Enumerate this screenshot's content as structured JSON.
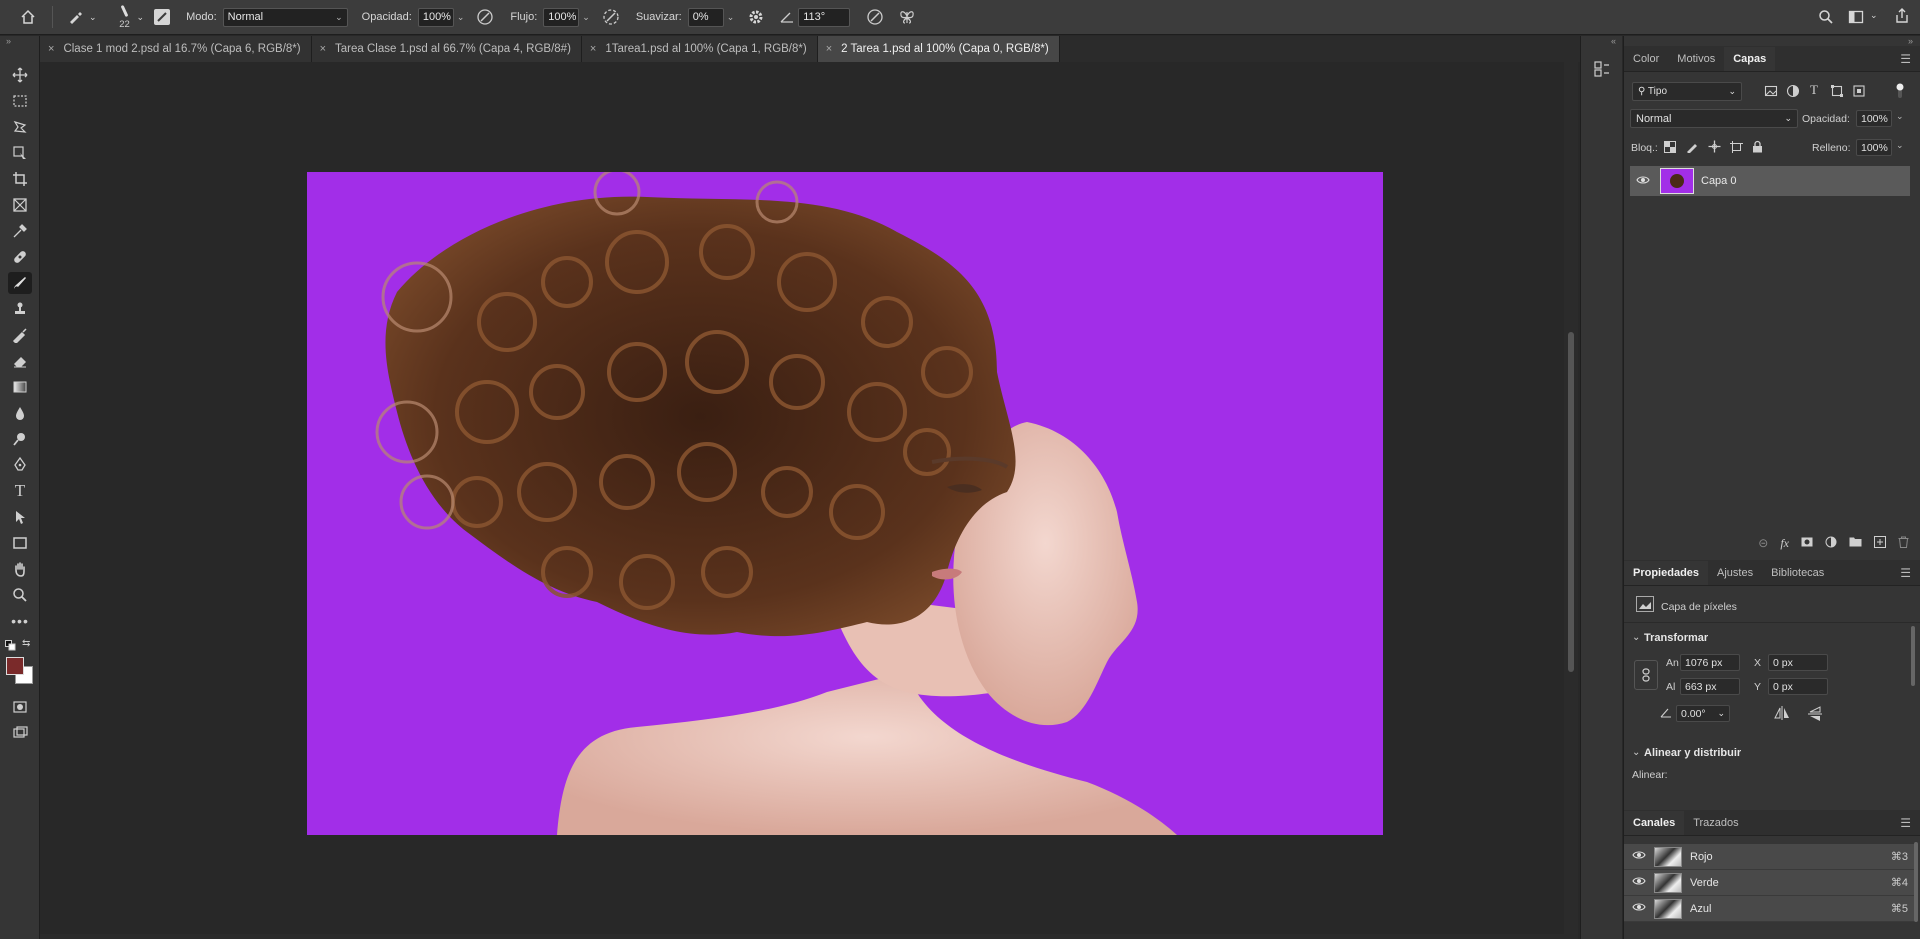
{
  "options_bar": {
    "brush_size": "22",
    "mode_label": "Modo:",
    "mode_value": "Normal",
    "opacity_label": "Opacidad:",
    "opacity_value": "100%",
    "flow_label": "Flujo:",
    "flow_value": "100%",
    "smoothing_label": "Suavizar:",
    "smoothing_value": "0%",
    "angle_value": "113°"
  },
  "tabs": [
    {
      "label": "Clase 1 mod 2.psd al 16.7% (Capa 6, RGB/8*)",
      "active": false
    },
    {
      "label": "Tarea Clase 1.psd al 66.7% (Capa 4, RGB/8#)",
      "active": false
    },
    {
      "label": "1Tarea1.psd al 100% (Capa 1, RGB/8*)",
      "active": false
    },
    {
      "label": "2 Tarea 1.psd al 100% (Capa 0, RGB/8*)",
      "active": true
    }
  ],
  "colors": {
    "canvas_bg": "#a22ee8",
    "foreground": "#7a2a2a",
    "background": "#ffffff"
  },
  "layers_panel": {
    "tabs": [
      "Color",
      "Motivos",
      "Capas"
    ],
    "active_tab": "Capas",
    "filter_value": "Tipo",
    "blend_mode": "Normal",
    "opacity_label": "Opacidad:",
    "opacity_value": "100%",
    "lock_label": "Bloq.:",
    "fill_label": "Relleno:",
    "fill_value": "100%",
    "layers": [
      {
        "name": "Capa 0",
        "visible": true
      }
    ]
  },
  "properties_panel": {
    "tabs": [
      "Propiedades",
      "Ajustes",
      "Bibliotecas"
    ],
    "active_tab": "Propiedades",
    "kind": "Capa de píxeles",
    "transform_title": "Transformar",
    "width_label": "An",
    "width_value": "1076 px",
    "height_label": "Al",
    "height_value": "663 px",
    "x_label": "X",
    "x_value": "0 px",
    "y_label": "Y",
    "y_value": "0 px",
    "angle_value": "0.00°",
    "align_title": "Alinear y distribuir",
    "align_label": "Alinear:"
  },
  "channels_panel": {
    "tabs": [
      "Canales",
      "Trazados"
    ],
    "active_tab": "Canales",
    "channels": [
      {
        "name": "Rojo",
        "shortcut": "⌘3"
      },
      {
        "name": "Verde",
        "shortcut": "⌘4"
      },
      {
        "name": "Azul",
        "shortcut": "⌘5"
      }
    ]
  }
}
